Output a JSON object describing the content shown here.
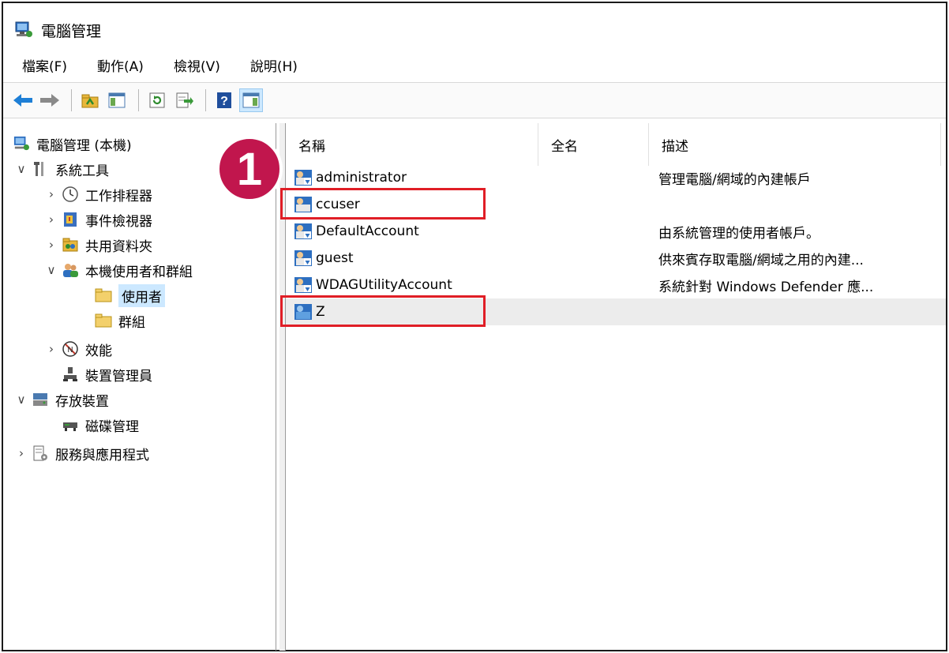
{
  "window": {
    "title": "電腦管理"
  },
  "menu": [
    {
      "label": "檔案(F)"
    },
    {
      "label": "動作(A)"
    },
    {
      "label": "檢視(V)"
    },
    {
      "label": "說明(H)"
    }
  ],
  "toolbar": {
    "buttons": [
      "back-icon",
      "forward-icon",
      "up-folder-icon",
      "show-hide-tree-icon",
      "refresh-icon",
      "export-list-icon",
      "help-icon",
      "action-pane-icon"
    ]
  },
  "tree": {
    "root": "電腦管理 (本機)",
    "system_tools": "系統工具",
    "task_scheduler": "工作排程器",
    "event_viewer": "事件檢視器",
    "shared_folders": "共用資料夾",
    "local_users_groups": "本機使用者和群組",
    "users": "使用者",
    "groups": "群組",
    "performance": "效能",
    "device_manager": "裝置管理員",
    "storage": "存放裝置",
    "disk_management": "磁碟管理",
    "services_apps": "服務與應用程式"
  },
  "list": {
    "columns": [
      "名稱",
      "全名",
      "描述"
    ],
    "rows": [
      {
        "name": "administrator",
        "full": "",
        "desc": "管理電腦/網域的內建帳戶"
      },
      {
        "name": "ccuser",
        "full": "",
        "desc": ""
      },
      {
        "name": "DefaultAccount",
        "full": "",
        "desc": "由系統管理的使用者帳戶。"
      },
      {
        "name": "guest",
        "full": "",
        "desc": "供來賓存取電腦/網域之用的內建..."
      },
      {
        "name": "WDAGUtilityAccount",
        "full": "",
        "desc": "系統針對 Windows Defender 應..."
      },
      {
        "name": "Z",
        "full": "",
        "desc": ""
      }
    ]
  },
  "annotation": {
    "badge": "1"
  },
  "colors": {
    "highlight_box": "#e01e26",
    "badge": "#c1164d",
    "selection": "#cce8ff"
  }
}
